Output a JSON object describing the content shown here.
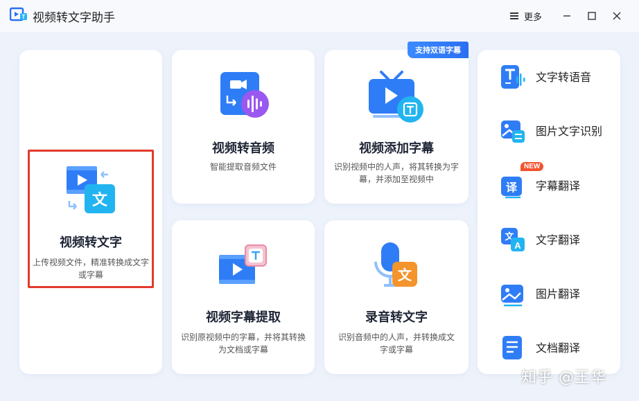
{
  "app": {
    "title": "视频转文字助手"
  },
  "window_controls": {
    "more_label": "更多"
  },
  "cards": {
    "video_to_text": {
      "title": "视频转文字",
      "desc": "上传视频文件，精准转换成文字或字幕"
    },
    "video_to_audio": {
      "title": "视频转音频",
      "desc": "智能提取音频文件"
    },
    "add_subtitles": {
      "title": "视频添加字幕",
      "desc": "识别视频中的人声，将其转换为字幕，并添加至视频中",
      "badge": "支持双语字幕"
    },
    "subtitle_extract": {
      "title": "视频字幕提取",
      "desc": "识别原视频中的字幕，并将其转换为文档或字幕"
    },
    "audio_to_text": {
      "title": "录音转文字",
      "desc": "识别音频中的人声，并转换成文字或字幕"
    }
  },
  "sidebar": {
    "items": [
      {
        "label": "文字转语音",
        "icon": "text-to-speech-icon"
      },
      {
        "label": "图片文字识别",
        "icon": "image-ocr-icon"
      },
      {
        "label": "字幕翻译",
        "icon": "subtitle-translate-icon",
        "tag": "NEW"
      },
      {
        "label": "文字翻译",
        "icon": "text-translate-icon"
      },
      {
        "label": "图片翻译",
        "icon": "image-translate-icon"
      },
      {
        "label": "文档翻译",
        "icon": "document-translate-icon"
      }
    ]
  },
  "watermark": "知乎 @王华",
  "colors": {
    "accent_blue": "#2a7af0",
    "highlight_red": "#e23a2b",
    "new_tag": "#f2532f",
    "background": "#eef3fb"
  }
}
